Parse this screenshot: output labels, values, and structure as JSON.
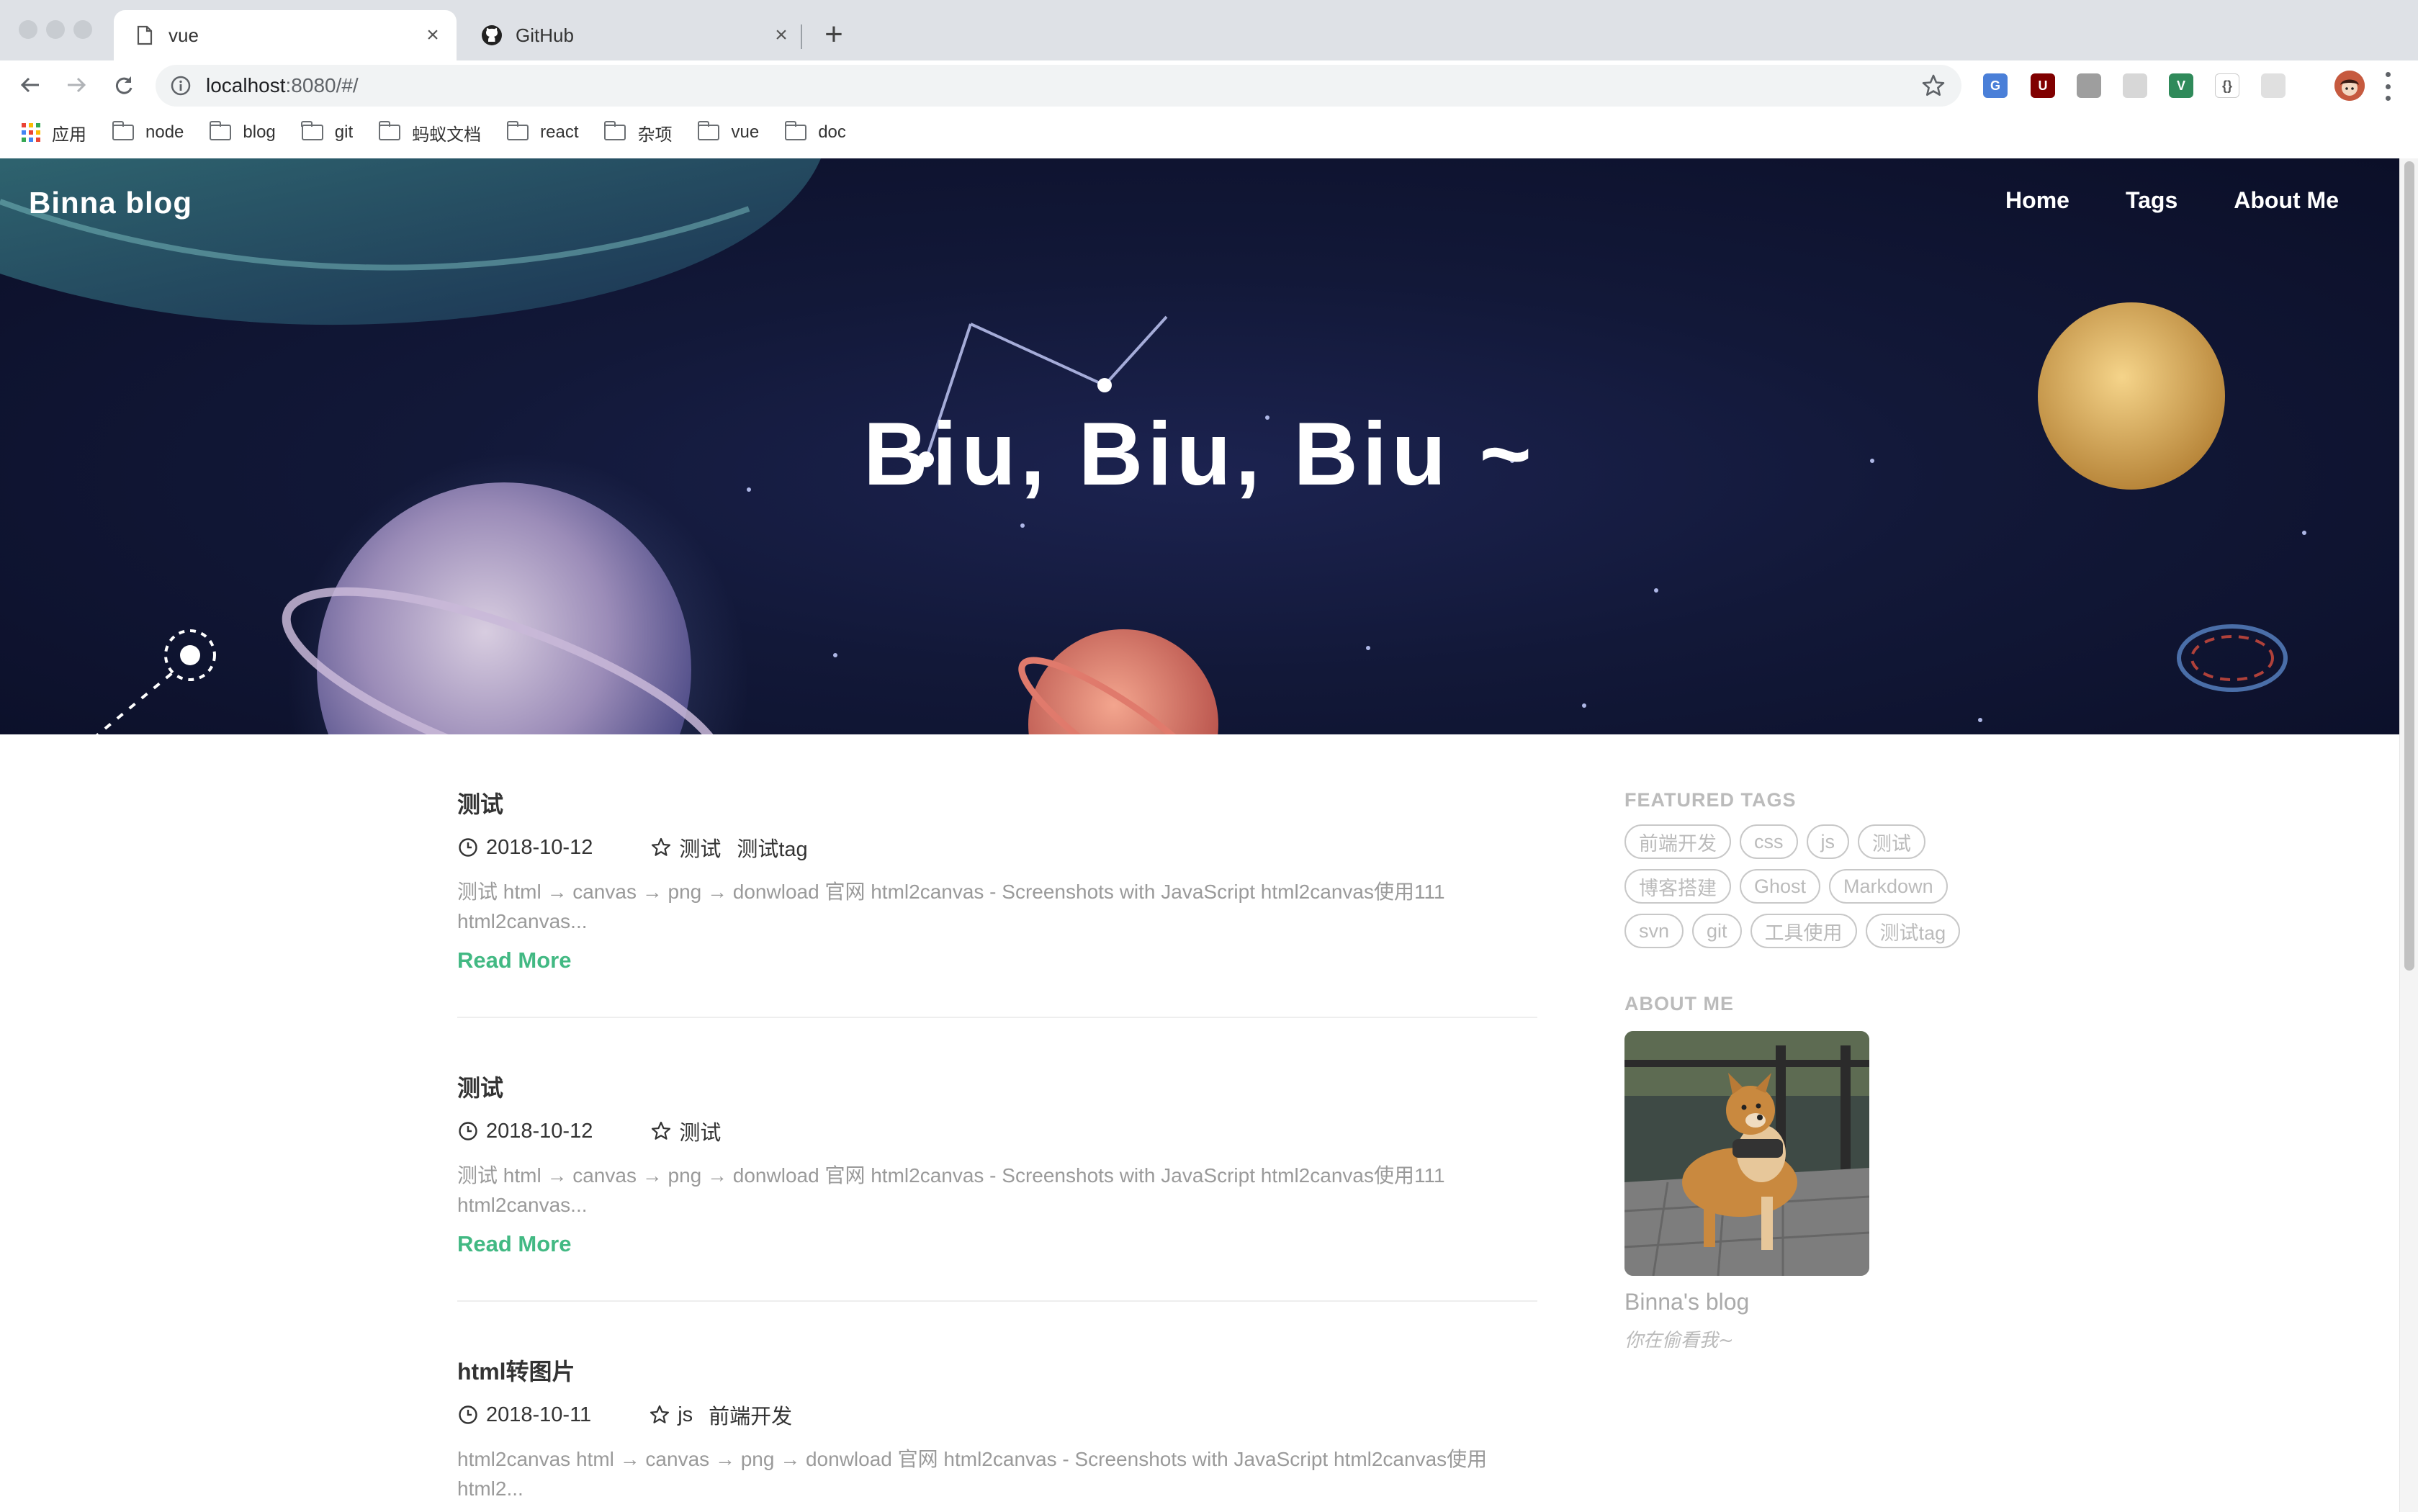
{
  "browser": {
    "tabs": [
      {
        "title": "vue",
        "active": true
      },
      {
        "title": "GitHub",
        "active": false
      }
    ],
    "url_host": "localhost",
    "url_rest": ":8080/#/",
    "bookmarks": [
      {
        "label": "应用",
        "icon": "apps-grid-icon"
      },
      {
        "label": "node",
        "icon": "folder-icon"
      },
      {
        "label": "blog",
        "icon": "folder-icon"
      },
      {
        "label": "git",
        "icon": "folder-icon"
      },
      {
        "label": "蚂蚁文档",
        "icon": "folder-icon"
      },
      {
        "label": "react",
        "icon": "folder-icon"
      },
      {
        "label": "杂项",
        "icon": "folder-icon"
      },
      {
        "label": "vue",
        "icon": "folder-icon"
      },
      {
        "label": "doc",
        "icon": "folder-icon"
      }
    ],
    "extensions": [
      {
        "name": "translate-extension-icon",
        "color": "#4a7fd8",
        "glyph": "G"
      },
      {
        "name": "ublock-extension-icon",
        "color": "#800000",
        "glyph": "U"
      },
      {
        "name": "document-extension-icon",
        "color": "#9e9e9e",
        "glyph": ""
      },
      {
        "name": "record-extension-icon",
        "color": "#d7d7d7",
        "glyph": ""
      },
      {
        "name": "vue-devtools-extension-icon",
        "color": "#2f8a5a",
        "glyph": "V"
      },
      {
        "name": "json-extension-icon",
        "color": "#ffffff",
        "glyph": "{}"
      },
      {
        "name": "qr-extension-icon",
        "color": "#e0e0e0",
        "glyph": ""
      }
    ]
  },
  "site": {
    "brand": "Binna blog",
    "nav": [
      "Home",
      "Tags",
      "About Me"
    ],
    "hero_title": "Biu, Biu, Biu ~",
    "read_more_label": "Read More"
  },
  "posts": [
    {
      "title": "测试",
      "date": "2018-10-12",
      "tags": [
        "测试",
        "测试tag"
      ],
      "excerpt": "测试 html → canvas → png → donwload 官网 html2canvas - Screenshots with JavaScript html2canvas使用111 html2canvas..."
    },
    {
      "title": "测试",
      "date": "2018-10-12",
      "tags": [
        "测试"
      ],
      "excerpt": "测试 html → canvas → png → donwload 官网 html2canvas - Screenshots with JavaScript html2canvas使用111 html2canvas..."
    },
    {
      "title": "html转图片",
      "date": "2018-10-11",
      "tags": [
        "js",
        "前端开发"
      ],
      "excerpt": "html2canvas html → canvas → png → donwload 官网 html2canvas - Screenshots with JavaScript html2canvas使用 html2..."
    }
  ],
  "sidebar": {
    "featured_tags_heading": "FEATURED TAGS",
    "featured_tags": [
      "前端开发",
      "css",
      "js",
      "测试",
      "博客搭建",
      "Ghost",
      "Markdown",
      "svn",
      "git",
      "工具使用",
      "测试tag"
    ],
    "about_heading": "ABOUT ME",
    "owner_name": "Binna's blog",
    "motto": "你在偷看我~"
  },
  "colors": {
    "accent": "#42b983",
    "hero_bg": "#121838"
  }
}
